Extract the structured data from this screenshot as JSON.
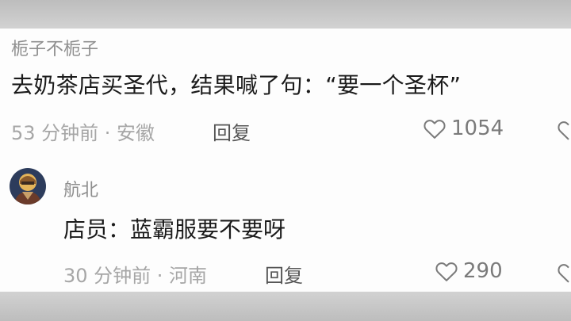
{
  "comments": [
    {
      "username": "栀子不栀子",
      "text": "去奶茶店买圣代，结果喊了句：“要一个圣杯”",
      "meta": "53 分钟前 · 安徽",
      "reply_label": "回复",
      "like_count": "1054",
      "like_icon": "heart-outline-icon"
    },
    {
      "username": "航北",
      "text": "店员：蓝霸服要不要呀",
      "meta": "30 分钟前 · 河南",
      "reply_label": "回复",
      "like_count": "290",
      "like_icon": "heart-outline-icon"
    }
  ],
  "colors": {
    "background": "#fdfdfd",
    "frame": "#c9c9c9",
    "username": "#8e8e8e",
    "body_text": "#1a1a1a",
    "meta_text": "#a6a6a6",
    "icon": "#7a7a7a"
  }
}
